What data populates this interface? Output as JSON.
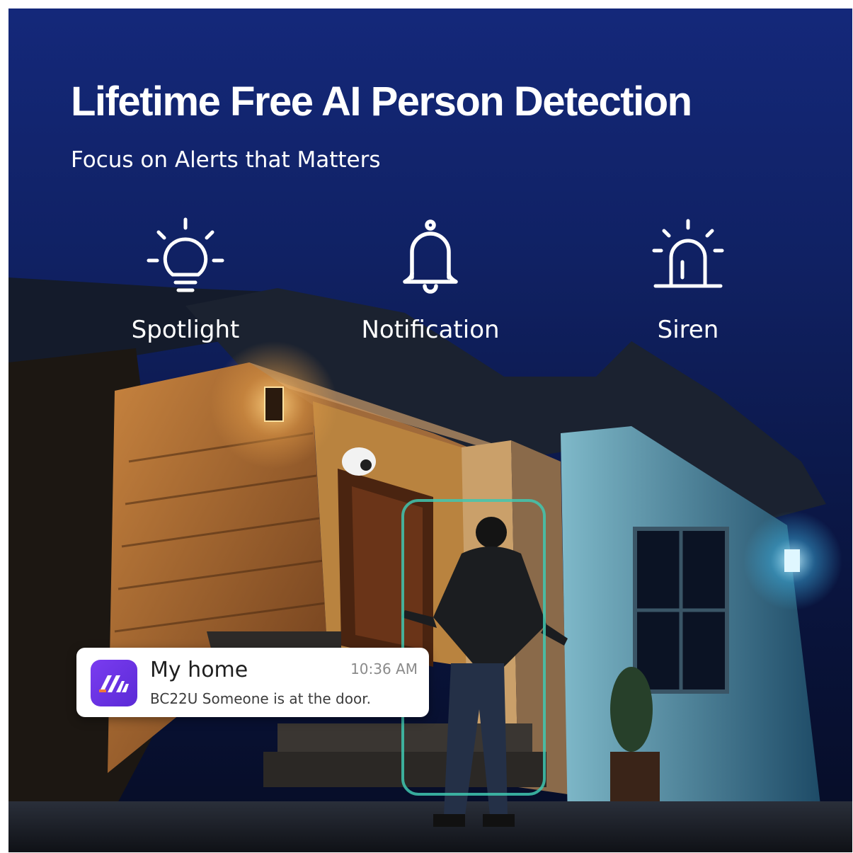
{
  "headline": "Lifetime Free AI Person Detection",
  "subheadline": "Focus on Alerts that Matters",
  "features": [
    {
      "label": "Spotlight",
      "icon": "lightbulb-icon"
    },
    {
      "label": "Notification",
      "icon": "bell-icon"
    },
    {
      "label": "Siren",
      "icon": "siren-icon"
    }
  ],
  "notification": {
    "app_icon": "app-logo-icon",
    "title": "My home",
    "time": "10:36 AM",
    "message": "BC22U Someone is at the door."
  },
  "colors": {
    "sky": "#102163",
    "warm_light": "#f2b45a",
    "cool_light": "#5fd1f2",
    "detection_box": "#3fc7b0",
    "app_icon": "#6a33e4"
  }
}
